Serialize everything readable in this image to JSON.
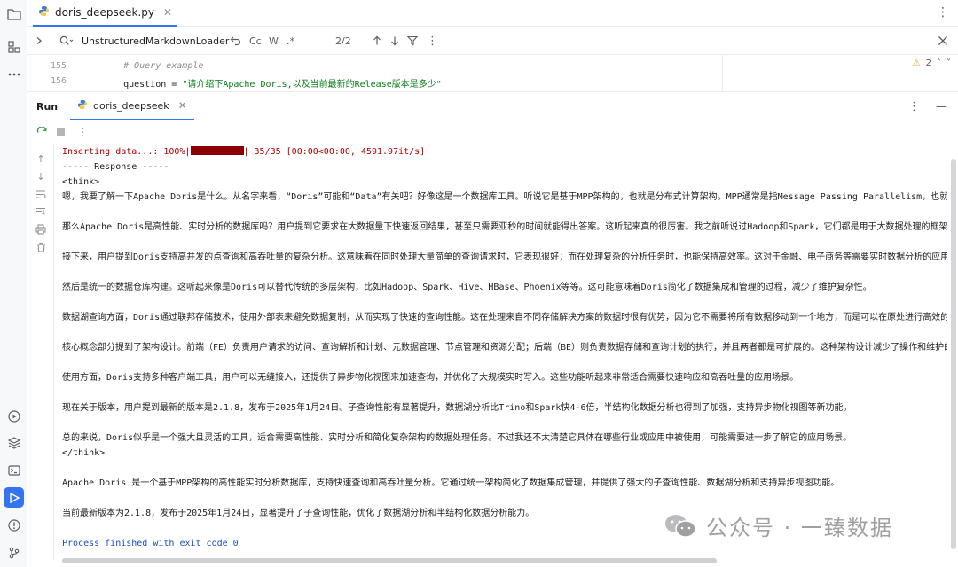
{
  "editor": {
    "file_tab": "doris_deepseek.py"
  },
  "search": {
    "query": "UnstructuredMarkdownLoader",
    "cc": "Cc",
    "w": "W",
    "regex": ".*",
    "match_count": "2/2"
  },
  "code": {
    "lines": [
      {
        "num": "155",
        "text": "    # Query example"
      },
      {
        "num": "156",
        "prefix": "    question = ",
        "string": "\"请介绍下Apache Doris,以及当前最新的Release版本是多少\""
      }
    ],
    "warning_count": "2"
  },
  "run": {
    "label": "Run",
    "tab": "doris_deepseek"
  },
  "console": {
    "progress_prefix": "Inserting data...: 100%|",
    "progress_suffix": "| 35/35 [00:00<00:00, 4591.97it/s]",
    "lines": [
      "----- Response -----",
      "<think>",
      "嗯，我要了解一下Apache Doris是什么。从名字来看，“Doris”可能和“Data”有关吧？好像这是一个数据库工具。听说它是基于MPP架构的，也就是分布式计算架构。MPP通常是指Message Passing Parallelism，也就",
      "那么Apache Doris是高性能、实时分析的数据库吗？用户提到它要求在大数据量下快速返回结果，甚至只需要亚秒的时间就能得出答案。这听起来真的很厉害。我之前听说过Hadoop和Spark，它们都是用于大数据处理的框架",
      "接下来，用户提到Doris支持高并发的点查询和高吞吐量的复杂分析。这意味着在同时处理大量简单的查询请求时，它表现很好；而在处理复杂的分析任务时，也能保持高效率。这对于金融、电子商务等需要实时数据分析的应用",
      "然后是统一的数据仓库构建。这听起来像是Doris可以替代传统的多层架构，比如Hadoop、Spark、Hive、HBase、Phoenix等等。这可能意味着Doris简化了数据集成和管理的过程，减少了维护复杂性。",
      "数据湖查询方面，Doris通过联邦存储技术，使用外部表来避免数据复制，从而实现了快速的查询性能。这在处理来自不同存储解决方案的数据时很有优势，因为它不需要将所有数据移动到一个地方，而是可以在原处进行高效的",
      "核心概念部分提到了架构设计。前端（FE）负责用户请求的访问、查询解析和计划、元数据管理、节点管理和资源分配；后端（BE）则负责数据存储和查询计划的执行，并且两者都是可扩展的。这种架构设计减少了操作和维护的",
      "使用方面，Doris支持多种客户端工具，用户可以无缝接入，还提供了异步物化视图来加速查询，并优化了大规模实时写入。这些功能听起来非常适合需要快速响应和高吞吐量的应用场景。",
      "现在关于版本，用户提到最新的版本是2.1.8，发布于2025年1月24日。子查询性能有显著提升，数据湖分析比Trino和Spark快4-6倍，半结构化数据分析也得到了加强，支持异步物化视图等新功能。",
      "总的来说，Doris似乎是一个强大且灵活的工具，适合需要高性能、实时分析和简化复杂架构的数据处理任务。不过我还不太清楚它具体在哪些行业或应用中被使用，可能需要进一步了解它的应用场景。",
      "</think>",
      "Apache Doris 是一个基于MPP架构的高性能实时分析数据库，支持快速查询和高吞吐量分析。它通过统一架构简化了数据集成管理，并提供了强大的子查询性能、数据湖分析和支持异步视图功能。",
      "当前最新版本为2.1.8，发布于2025年1月24日，显著提升了子查询性能，优化了数据湖分析和半结构化数据分析能力。"
    ],
    "exit": "Process finished with exit code 0"
  },
  "watermark": {
    "text": "公众号 · 一臻数据"
  },
  "colors": {
    "accent": "#3574f0",
    "console_red": "#b00000",
    "string_green": "#067d17",
    "exit_blue": "#1a4fbf"
  }
}
